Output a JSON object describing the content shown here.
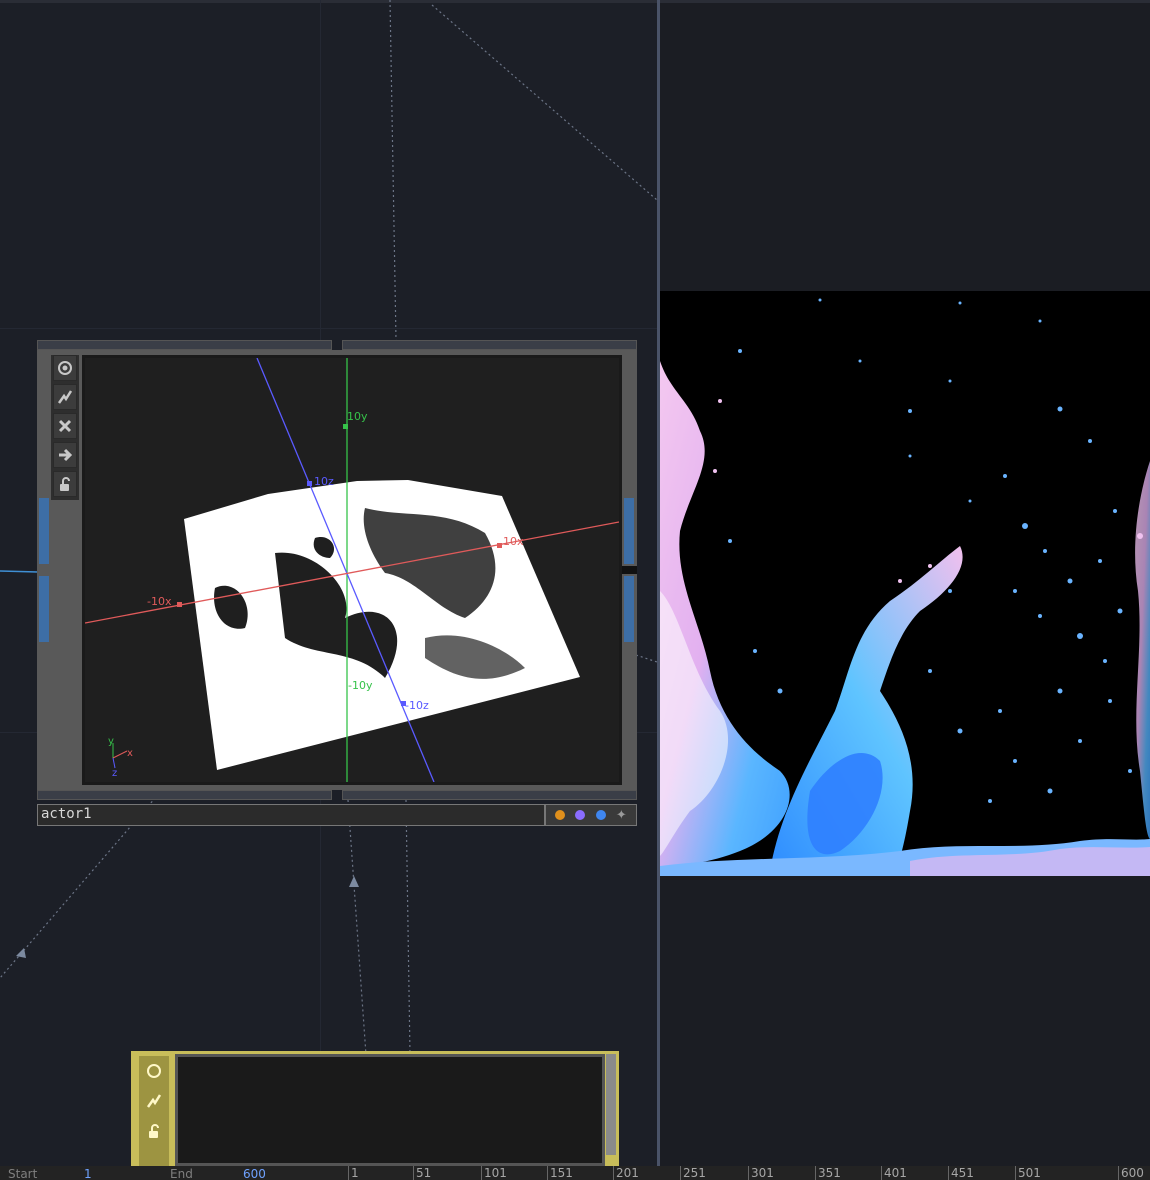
{
  "node_actor": {
    "name": "actor1",
    "toolbar_icons": [
      "viewer-toggle-icon",
      "cook-icon",
      "bypass-icon",
      "display-arrow-icon",
      "lock-icon"
    ],
    "axis_labels": {
      "y_pos": "10y",
      "y_neg": "-10y",
      "z_pos": "10z",
      "z_neg": "-10z",
      "x_pos": "10x",
      "x_neg": "-10x"
    },
    "gizmo_labels": {
      "x": "x",
      "y": "y",
      "z": "z"
    },
    "flag_colors": [
      "#e0901c",
      "#8a6cff",
      "#3f86ef",
      "#9a9a9a"
    ]
  },
  "node_bottom": {
    "toolbar_icons": [
      "viewer-toggle-icon",
      "cook-icon",
      "lock-icon"
    ],
    "color": "#c8bd5a"
  },
  "timeline": {
    "start_label": "Start",
    "start_value": "1",
    "end_label": "End",
    "end_value": "600",
    "ticks": [
      "1",
      "51",
      "101",
      "151",
      "201",
      "251",
      "301",
      "351",
      "401",
      "451",
      "501",
      "600"
    ]
  },
  "colors": {
    "x_axis": "#e05a5a",
    "y_axis": "#36c24a",
    "z_axis": "#5a5aff",
    "background": "#1c1f27"
  }
}
